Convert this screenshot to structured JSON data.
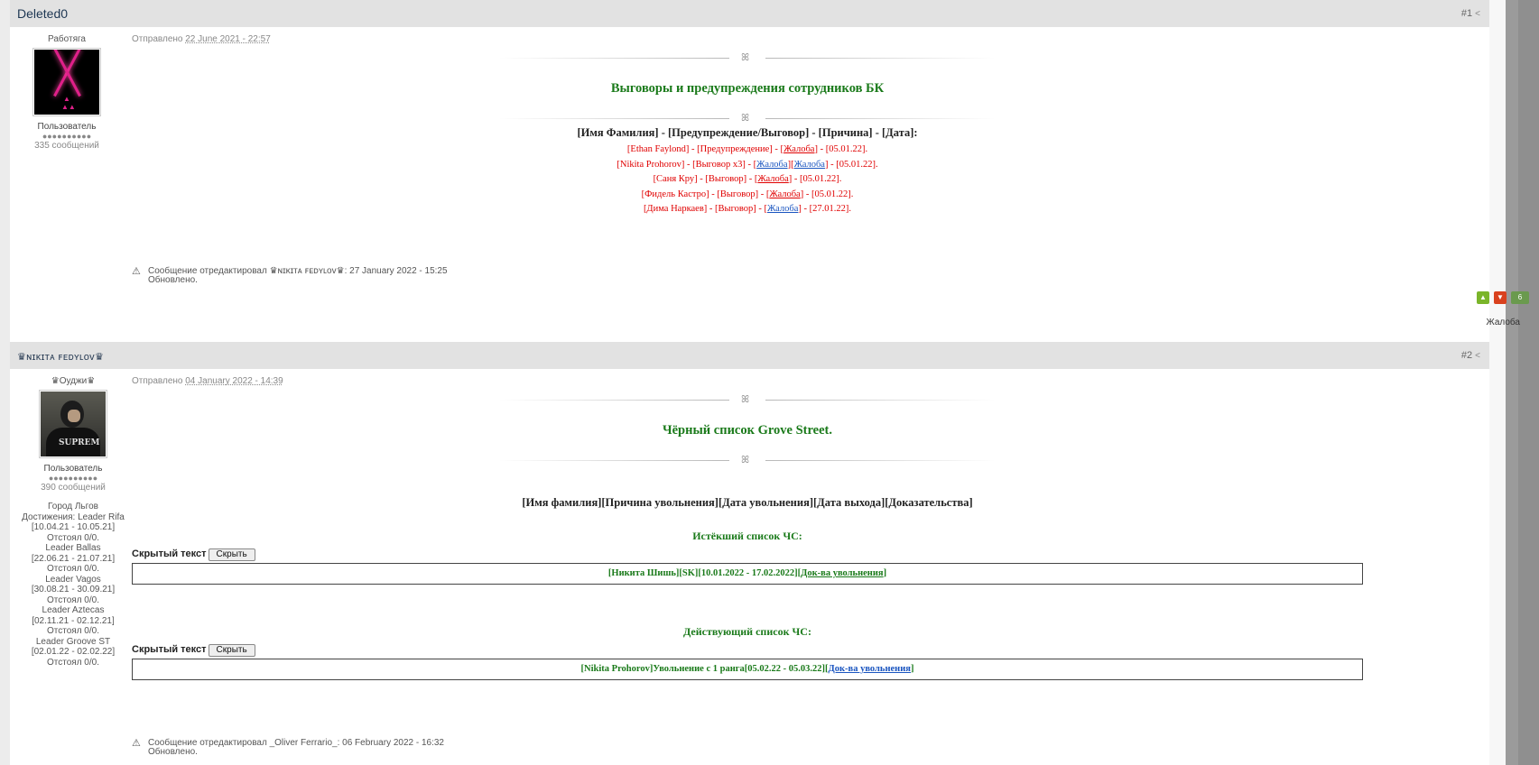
{
  "posts": [
    {
      "author": "Deleted0",
      "number": "#1",
      "rank_title": "Работяга",
      "group": "Пользователь",
      "pips": "●●●●●●●●●●",
      "post_count": "335 сообщений",
      "posted_prefix": "Отправлено",
      "posted_date": "22 June 2021 - 22:57",
      "title": "Выговоры и предупреждения сотрудников БК",
      "header_row": "[Имя Фамилия] - [Предупреждение/Выговор] - [Причина] - [Дата]:",
      "rows": [
        {
          "pre": "[Ethan Faylond] - [Предупреждение] - [",
          "link1": "Жалоба",
          "mid": "",
          "link2": "",
          "post": "] - [05.01.22]."
        },
        {
          "pre": "[Nikita Prohorov] - [Выговор x3] - [",
          "link1": "Жалоба",
          "mid": "][",
          "link2": "Жалоба",
          "post": "] - [05.01.22]."
        },
        {
          "pre": "[Саня Кру] - [Выговор] - [",
          "link1": "Жалоба",
          "mid": "",
          "link2": "",
          "post": "] - [05.01.22]."
        },
        {
          "pre": "[Фидель Кастро] - [Выговор] - [",
          "link1": "Жалоба",
          "mid": "",
          "link2": "",
          "post": "] - [05.01.22]."
        },
        {
          "pre": "[Дима Наркаев] - [Выговор] - [",
          "link1": "Жалоба",
          "mid": "",
          "link2": "",
          "post": "] - [27.01.22]."
        }
      ],
      "edit_text": "Сообщение отредактировал ♛ɴɪᴋɪᴛᴀ ꜰᴇᴅʏʟᴏᴠ♛: 27 January 2022 - 15:25",
      "edit_reason": "Обновлено.",
      "rep_count": "6",
      "report_label": "Жалоба"
    },
    {
      "author": "♛ɴɪᴋɪᴛᴀ ꜰᴇᴅʏʟᴏᴠ♛",
      "number": "#2",
      "rank_title": "♛Оуджи♛",
      "group": "Пользователь",
      "pips": "●●●●●●●●●●",
      "post_count": "390 сообщений",
      "custom_fields": [
        "Город Льгов",
        "Достижения: Leader Rifa",
        "[10.04.21 - 10.05.21]",
        "Отстоял 0/0.",
        "Leader Ballas",
        "[22.06.21 - 21.07.21]",
        "Отстоял 0/0.",
        "Leader Vagos",
        "[30.08.21 - 30.09.21]",
        "Отстоял 0/0.",
        "Leader Aztecas",
        "[02.11.21 - 02.12.21]",
        "Отстоял 0/0.",
        "Leader Groove ST",
        "[02.01.22 - 02.02.22]",
        "Отстоял 0/0."
      ],
      "posted_prefix": "Отправлено",
      "posted_date": "04 January 2022 - 14:39",
      "title": "Чёрный список Grove Street.",
      "header_row": "[Имя фамилия][Причина увольнения][Дата увольнения][Дата выхода][Доказательства]",
      "section1_title": "Истёкший список ЧС:",
      "spoiler_label": "Скрытый текст",
      "spoiler_button": "Скрыть",
      "section1_row_pre": "[Никита Шишь][SK][10.01.2022 - 17.02.2022][",
      "section1_row_link": "Док-ва увольнения",
      "section1_row_post": "]",
      "section2_title": "Действующий список ЧС:",
      "section2_row_pre": "[Nikita Prohorov]Увольнение с 1 ранга[05.02.22 - 05.03.22][",
      "section2_row_link": "Док-ва увольнения",
      "section2_row_post": "]",
      "edit_text": "Сообщение отредактировал _Oliver Ferrario_: 06 February 2022 - 16:32",
      "edit_reason": "Обновлено."
    }
  ],
  "colors": {
    "header_bg": "#e2e2e2",
    "title_green": "#1a7a1a",
    "row_red": "#e00000",
    "link_blue": "#1a55c0"
  }
}
